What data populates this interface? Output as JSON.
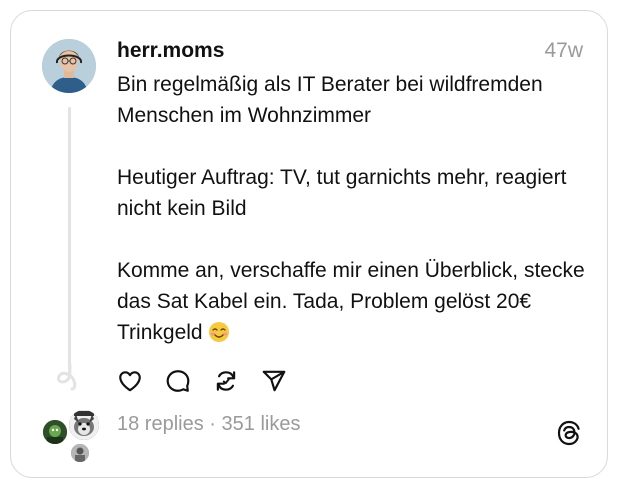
{
  "post": {
    "username": "herr.moms",
    "timestamp": "47w",
    "paragraphs": [
      "Bin regelmäßig als IT Berater bei wildfremden Menschen im Wohnzimmer",
      "Heutiger Auftrag: TV, tut garnichts mehr, reagiert nicht kein Bild",
      "Komme an, verschaffe mir einen Überblick, stecke das Sat Kabel ein. Tada, Problem gelöst"
    ],
    "last_line_prefix": "20€ Trinkgeld",
    "emoji": "smiling-face-emoji"
  },
  "actions": {
    "like": "heart-icon",
    "reply": "comment-bubble-icon",
    "repost": "repost-icon",
    "share": "send-icon"
  },
  "stats": {
    "replies": "18 replies",
    "separator": "·",
    "likes": "351 likes"
  },
  "colors": {
    "text": "#111111",
    "muted": "#9a9a9a",
    "border": "#d9d9d9",
    "thread_line": "#e3e3e3"
  },
  "logo": "threads-logo-icon"
}
